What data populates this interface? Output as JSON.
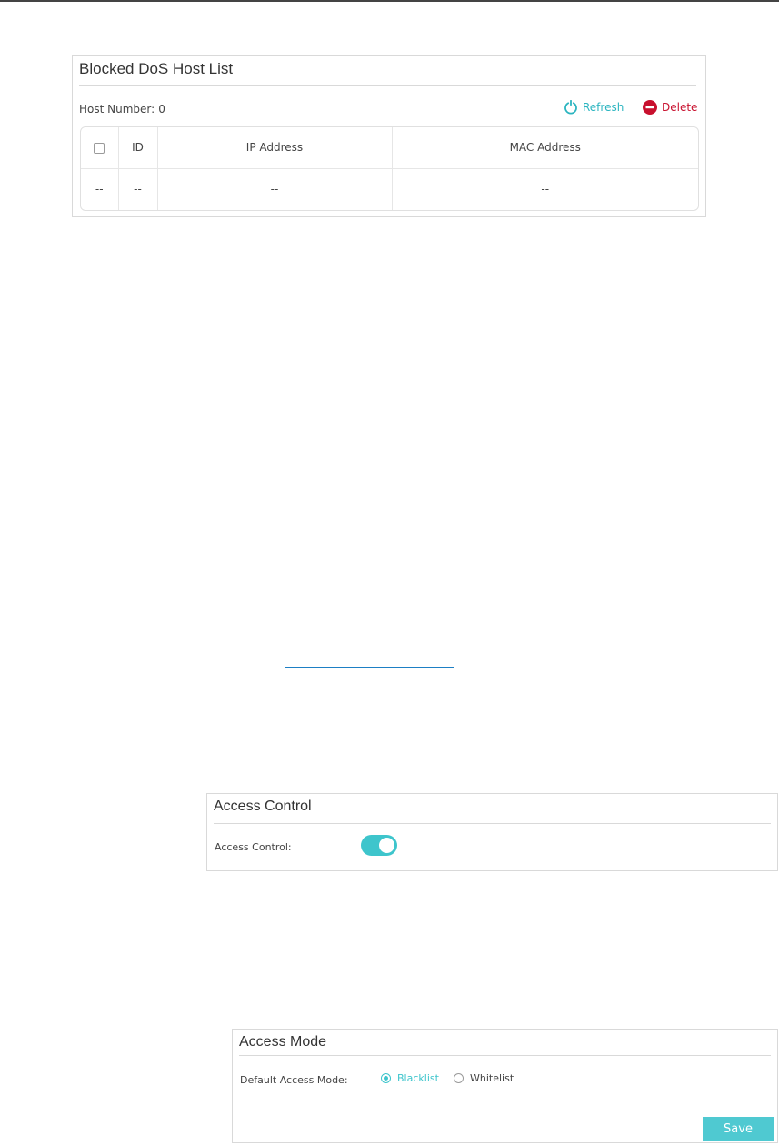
{
  "dos_host_list": {
    "title": "Blocked DoS Host List",
    "host_number_label": "Host Number:",
    "host_number_value": "0",
    "refresh_label": "Refresh",
    "delete_label": "Delete",
    "columns": [
      "ID",
      "IP Address",
      "MAC Address"
    ],
    "rows": [
      {
        "checkbox": "--",
        "id": "--",
        "ip": "--",
        "mac": "--"
      }
    ]
  },
  "access_control": {
    "title": "Access Control",
    "label": "Access Control:",
    "enabled": true
  },
  "access_mode": {
    "title": "Access Mode",
    "label": "Default Access Mode:",
    "options": [
      "Blacklist",
      "Whitelist"
    ],
    "selected": "Blacklist",
    "save_label": "Save"
  },
  "colors": {
    "accent": "#3ec5cc",
    "delete": "#c8102e",
    "link": "#1d7fc4"
  },
  "icons": {
    "refresh": "refresh-icon",
    "delete": "minus-circle-icon"
  }
}
